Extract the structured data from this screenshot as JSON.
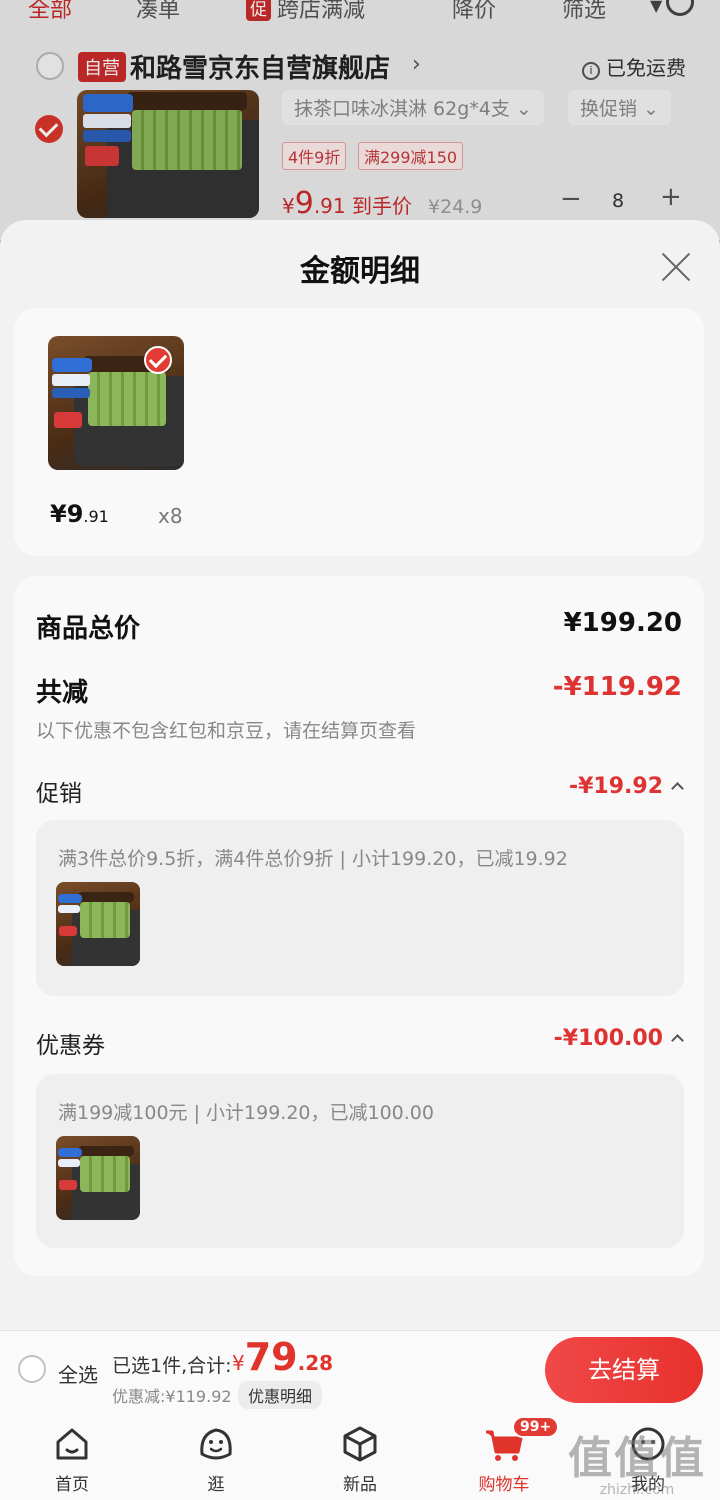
{
  "filter_tabs": [
    {
      "label": "全部"
    },
    {
      "label": "凑单"
    },
    {
      "tag": "促",
      "label": "跨店满减"
    },
    {
      "label": "降价"
    },
    {
      "label": "筛选"
    }
  ],
  "store": {
    "self_tag": "自营",
    "name": "和路雪京东自营旗舰店",
    "chevron": "›",
    "shipping": "已免运费",
    "info_glyph": "i"
  },
  "product": {
    "spec": "抹茶口味冰淇淋 62g*4支 ⌄",
    "promo_select": "换促销 ⌄",
    "tags": [
      "4件9折",
      "满299减150"
    ],
    "price_yen": "¥",
    "price_int": "9",
    "price_dec": ".91 到手价",
    "orig_price": "¥24.9",
    "minus": "−",
    "qty": "8",
    "plus": "+"
  },
  "sheet": {
    "title": "金额明细",
    "item": {
      "price_int": "¥9",
      "price_dec": ".91",
      "qty": "x8"
    },
    "summary": {
      "total_label": "商品总价",
      "total_value": "¥199.20",
      "reduce_label": "共减",
      "reduce_value": "-¥119.92",
      "note": "以下优惠不包含红包和京豆，请在结算页查看"
    },
    "promotion": {
      "label": "促销",
      "value": "-¥19.92",
      "detail": "满3件总价9.5折，满4件总价9折 | 小计199.20，已减19.92"
    },
    "coupon": {
      "label": "优惠券",
      "value": "-¥100.00",
      "detail": "满199减100元 | 小计199.20，已减100.00"
    }
  },
  "checkout": {
    "select_all": "全选",
    "selected_summary": "已选1件,合计:",
    "total_yen": "¥",
    "total_int": "79",
    "total_dec": ".28",
    "discount": "优惠减:¥119.92",
    "detail_chip": "优惠明细",
    "checkout_button": "去结算"
  },
  "nav": [
    {
      "label": "首页",
      "icon": "home-icon"
    },
    {
      "label": "逛",
      "icon": "smiley-icon"
    },
    {
      "label": "新品",
      "icon": "box-icon"
    },
    {
      "label": "购物车",
      "icon": "cart-icon",
      "badge": "99+",
      "active": true
    },
    {
      "label": "我的",
      "icon": "profile-icon"
    }
  ],
  "watermark": {
    "glyphs": "值值值",
    "domain": "zhizhi.com"
  },
  "colors": {
    "accent": "#e0332b",
    "sheet_bg": "#f2f2f2",
    "card_bg": "#f9f9f9"
  }
}
